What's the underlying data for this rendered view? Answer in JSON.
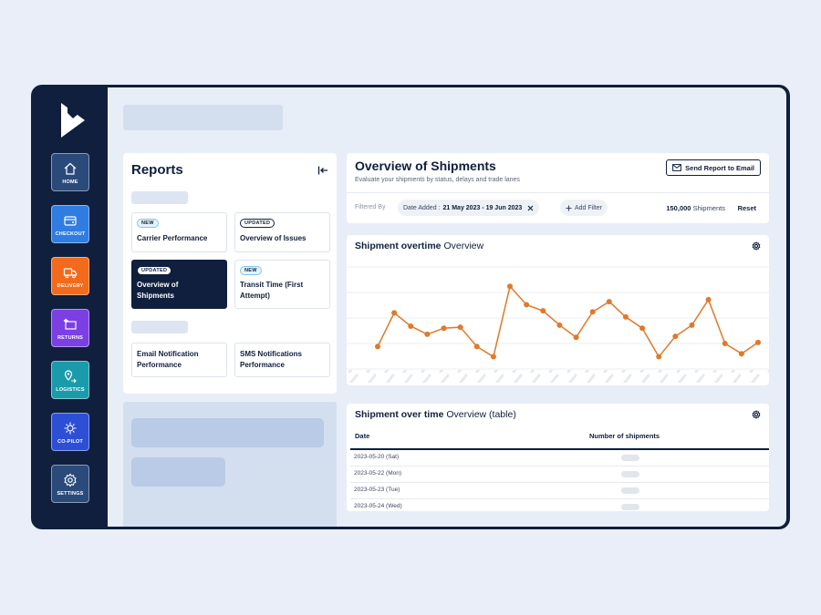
{
  "sidebar": {
    "items": [
      {
        "label": "HOME",
        "icon": "home-icon",
        "color": "#2a4a7a"
      },
      {
        "label": "CHECKOUT",
        "icon": "cart-icon",
        "color": "#2f7de0"
      },
      {
        "label": "DELIVERY",
        "icon": "truck-icon",
        "color": "#f26a1b"
      },
      {
        "label": "RETURNS",
        "icon": "return-icon",
        "color": "#7b3fe4"
      },
      {
        "label": "LOGISTICS",
        "icon": "map-pin-icon",
        "color": "#1a9bab"
      },
      {
        "label": "CO-PILOT",
        "icon": "copilot-icon",
        "color": "#2d4fd6"
      },
      {
        "label": "SETTINGS",
        "icon": "gear-icon",
        "color": "#2a4a7a"
      }
    ]
  },
  "reports": {
    "title": "Reports",
    "cards": [
      {
        "badge": "NEW",
        "title": "Carrier Performance"
      },
      {
        "badge": "UPDATED",
        "title": "Overview of Issues"
      },
      {
        "badge": "UPDATED",
        "title": "Overview of Shipments",
        "active": true
      },
      {
        "badge": "NEW",
        "title": "Transit Time (First Attempt)"
      },
      {
        "badge": "",
        "title": "Email Notification Performance"
      },
      {
        "badge": "",
        "title": "SMS Notifications Performance"
      }
    ]
  },
  "overview": {
    "title": "Overview of Shipments",
    "subtitle": "Evaluate your shipments by status, delays and trade lanes",
    "send_button": "Send Report to Email",
    "filtered_by": "Filtered By",
    "date_filter_label": "Date Added :",
    "date_filter_value": "21 May 2023  -  19 Jun 2023",
    "add_filter": "Add Filter",
    "shipment_count": "150,000",
    "shipment_count_suffix": "Shipments",
    "reset": "Reset"
  },
  "chart_panel": {
    "title_bold": "Shipment overtime",
    "title_rest": "Overview"
  },
  "chart_data": {
    "type": "line",
    "color": "#e0792b",
    "values": [
      22,
      55,
      42,
      34,
      40,
      41,
      22,
      12,
      81,
      63,
      57,
      43,
      31,
      56,
      66,
      51,
      40,
      12,
      32,
      43,
      68,
      25,
      15,
      26
    ],
    "ylim": [
      0,
      100
    ],
    "grid": true
  },
  "table_panel": {
    "title_bold": "Shipment over time",
    "title_rest": "Overview (table)",
    "col_date": "Date",
    "col_count": "Number of shipments",
    "rows": [
      "2023-05-20 (Sat)",
      "2023-05-22 (Mon)",
      "2023-05-23 (Tue)",
      "2023-05-24 (Wed)"
    ]
  }
}
